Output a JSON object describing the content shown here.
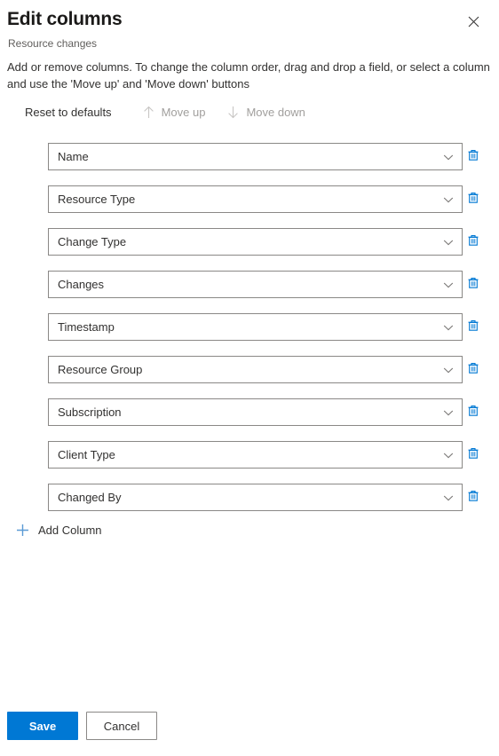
{
  "header": {
    "title": "Edit columns",
    "subtitle": "Resource changes",
    "close_icon": "close-icon"
  },
  "description": "Add or remove columns. To change the column order, drag and drop a field, or select a column and use the 'Move up' and 'Move down' buttons",
  "command_bar": {
    "reset_label": "Reset to defaults",
    "move_up_label": "Move up",
    "move_down_label": "Move down",
    "move_up_icon": "arrow-up-icon",
    "move_down_icon": "arrow-down-icon",
    "move_up_enabled": false,
    "move_down_enabled": false
  },
  "columns": [
    {
      "label": "Name"
    },
    {
      "label": "Resource Type"
    },
    {
      "label": "Change Type"
    },
    {
      "label": "Changes"
    },
    {
      "label": "Timestamp"
    },
    {
      "label": "Resource Group"
    },
    {
      "label": "Subscription"
    },
    {
      "label": "Client Type"
    },
    {
      "label": "Changed By"
    }
  ],
  "column_icons": {
    "chevron": "chevron-down-icon",
    "delete": "trash-icon"
  },
  "add_column": {
    "label": "Add Column",
    "icon": "plus-icon"
  },
  "footer": {
    "save_label": "Save",
    "cancel_label": "Cancel"
  },
  "colors": {
    "accent": "#0078d4",
    "trash": "#0078d4",
    "plus": "#5b9bd5",
    "border": "#8a8886",
    "text": "#323130",
    "muted": "#605e5c",
    "disabled": "#a19f9d"
  }
}
